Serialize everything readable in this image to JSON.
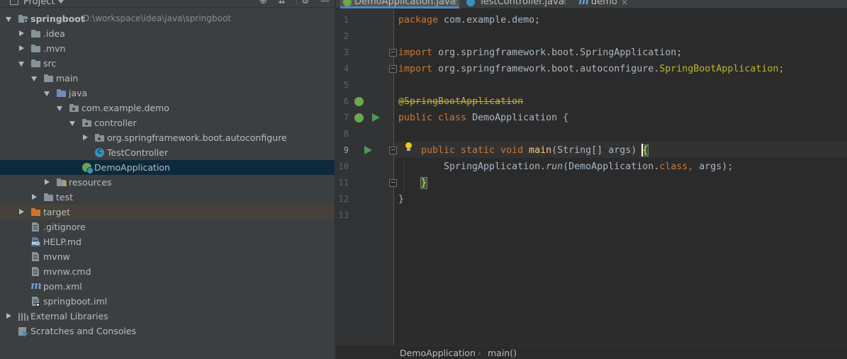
{
  "project_panel": {
    "title": "Project",
    "toolbar_icons": [
      "target-icon",
      "collapse-icon",
      "gear-icon",
      "hide-icon"
    ],
    "tree": [
      {
        "label": "springboot",
        "path": "D:\\workspace\\idea\\java\\springboot",
        "icon": "module-folder-icon",
        "expanded": true
      },
      {
        "label": ".idea",
        "icon": "folder-icon",
        "expanded": false
      },
      {
        "label": ".mvn",
        "icon": "folder-icon",
        "expanded": false
      },
      {
        "label": "src",
        "icon": "folder-icon",
        "expanded": true
      },
      {
        "label": "main",
        "icon": "folder-icon",
        "expanded": true
      },
      {
        "label": "java",
        "icon": "source-folder-icon",
        "expanded": true
      },
      {
        "label": "com.example.demo",
        "icon": "package-icon",
        "expanded": true
      },
      {
        "label": "controller",
        "icon": "package-icon",
        "expanded": true
      },
      {
        "label": "org.springframework.boot.autoconfigure",
        "icon": "package-icon",
        "expanded": false
      },
      {
        "label": "TestController",
        "icon": "class-icon"
      },
      {
        "label": "DemoApplication",
        "icon": "spring-boot-class-icon",
        "selected": true
      },
      {
        "label": "resources",
        "icon": "resources-folder-icon",
        "expanded": false
      },
      {
        "label": "test",
        "icon": "folder-icon",
        "expanded": false
      },
      {
        "label": "target",
        "icon": "excluded-folder-icon",
        "expanded": false
      },
      {
        "label": ".gitignore",
        "icon": "text-file-icon"
      },
      {
        "label": "HELP.md",
        "icon": "markdown-file-icon"
      },
      {
        "label": "mvnw",
        "icon": "text-file-icon"
      },
      {
        "label": "mvnw.cmd",
        "icon": "text-file-icon"
      },
      {
        "label": "pom.xml",
        "icon": "maven-icon"
      },
      {
        "label": "springboot.iml",
        "icon": "iml-file-icon"
      },
      {
        "label": "External Libraries",
        "icon": "libraries-icon",
        "expanded": false
      },
      {
        "label": "Scratches and Consoles",
        "icon": "scratches-icon"
      }
    ]
  },
  "editor": {
    "tabs": [
      {
        "label": "DemoApplication.java",
        "close": "×",
        "active": true
      },
      {
        "label": "TestController.java",
        "close": "×",
        "active": false
      },
      {
        "label": "demo",
        "close": "×",
        "active": false
      }
    ],
    "line_numbers": [
      "1",
      "2",
      "3",
      "4",
      "5",
      "6",
      "7",
      "8",
      "9",
      "10",
      "11",
      "12",
      "13"
    ],
    "current_line": "9",
    "code": {
      "l1_kw": "package",
      "l1_rest": " com.example.demo;",
      "l3_kw": "import",
      "l3_rest": " org.springframework.boot.SpringApplication;",
      "l4_kw": "import",
      "l4_rest": " org.springframework.boot.autoconfigure.",
      "l4_cls": "SpringBootApplication;",
      "l6_ann": "@SpringBootApplication",
      "l7_kw": "public class",
      "l7_rest": " DemoApplication {",
      "l9_kw": "public static void",
      "l9_fn": " main",
      "l9_rest": "(String[] args) ",
      "l9_brace": "{",
      "l10_a": "SpringApplication.",
      "l10_fn": "run",
      "l10_b": "(DemoApplication.",
      "l10_kw": "class,",
      "l10_c": " args);",
      "l11_brace": "}",
      "l12_brace": "}"
    },
    "breadcrumb": {
      "class": "DemoApplication",
      "separator": "›",
      "method": "main()"
    }
  },
  "colors": {
    "panel_bg": "#3c3f41",
    "editor_bg": "#2b2b2b",
    "selection": "#0d293e",
    "keyword": "#cc7832",
    "annotation": "#bbb529",
    "function": "#ffc66d"
  }
}
